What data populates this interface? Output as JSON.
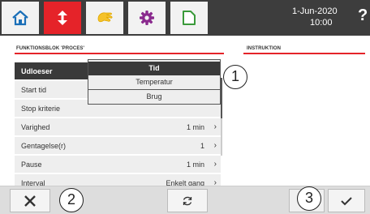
{
  "header": {
    "tabs": [
      {
        "icon": "home-icon",
        "active": false
      },
      {
        "icon": "program-arrows-icon",
        "active": true
      },
      {
        "icon": "hand-icon",
        "active": false
      },
      {
        "icon": "gear-icon",
        "active": false
      },
      {
        "icon": "document-icon",
        "active": false
      }
    ],
    "date": "1-Jun-2020",
    "time": "10:00",
    "help_label": "?"
  },
  "colors": {
    "topbar": "#3d3d3d",
    "accent": "#e52329",
    "row_bg": "#eeeeee",
    "row_selected": "#3a3a3a"
  },
  "left_panel": {
    "title": "FUNKTIONSBLOK 'PROCES'",
    "rows": [
      {
        "label": "Udloeser",
        "value": "",
        "selected": true
      },
      {
        "label": "Start tid",
        "value": ""
      },
      {
        "label": "Stop kriterie",
        "value": ""
      },
      {
        "label": "Varighed",
        "value": "1 min"
      },
      {
        "label": "Gentagelse(r)",
        "value": "1"
      },
      {
        "label": "Pause",
        "value": "1 min"
      },
      {
        "label": "Interval",
        "value": "Enkelt gang"
      }
    ]
  },
  "dropdown": {
    "options": [
      "Tid",
      "Temperatur",
      "Brug"
    ],
    "selected_index": 0
  },
  "right_panel": {
    "title": "INSTRUKTION"
  },
  "callouts": [
    "1",
    "2",
    "3"
  ],
  "bottom_bar": {
    "cancel_icon": "close-icon",
    "refresh_icon": "refresh-icon",
    "confirm_icon": "check-icon"
  }
}
